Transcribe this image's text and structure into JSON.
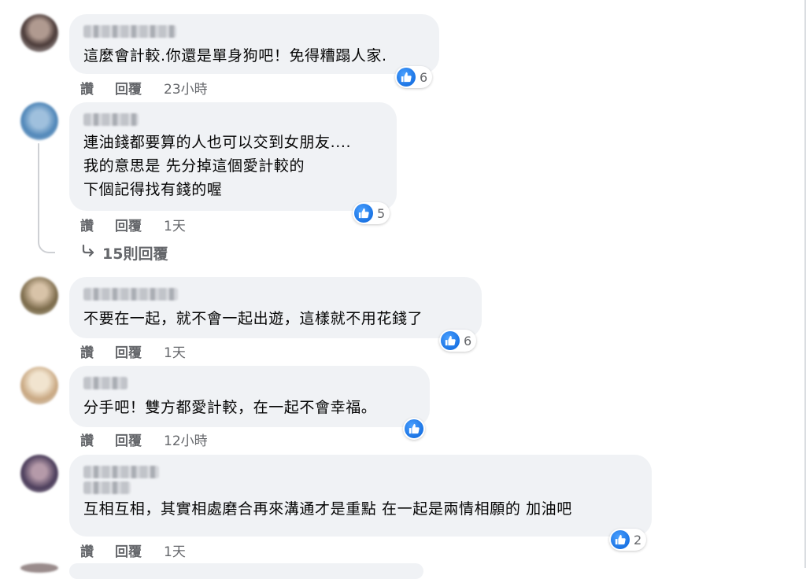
{
  "actions": {
    "like": "讚",
    "reply": "回覆"
  },
  "comments": [
    {
      "text": "這麼會計較.你還是單身狗吧！免得糟蹋人家.",
      "time": "23小時",
      "likes": "6"
    },
    {
      "text": "連油錢都要算的人也可以交到女朋友....\n我的意思是 先分掉這個愛計較的\n下個記得找有錢的喔",
      "time": "1天",
      "likes": "5"
    },
    {
      "text": "不要在一起，就不會一起出遊，這樣就不用花錢了",
      "time": "1天",
      "likes": "6"
    },
    {
      "text": "分手吧！雙方都愛計較，在一起不會幸福。",
      "time": "12小時",
      "likes": ""
    },
    {
      "text": "互相互相，其實相處磨合再來溝通才是重點 在一起是兩情相願的 加油吧",
      "time": "1天",
      "likes": "2"
    }
  ],
  "thread": {
    "more_replies": "15則回覆"
  },
  "icons": {
    "like": "thumbs-up-icon",
    "reply_arrow": "reply-arrow-icon"
  },
  "colors": {
    "like_blue": "#1b74e4",
    "bubble": "#f0f2f5",
    "meta_gray": "#65676b"
  }
}
